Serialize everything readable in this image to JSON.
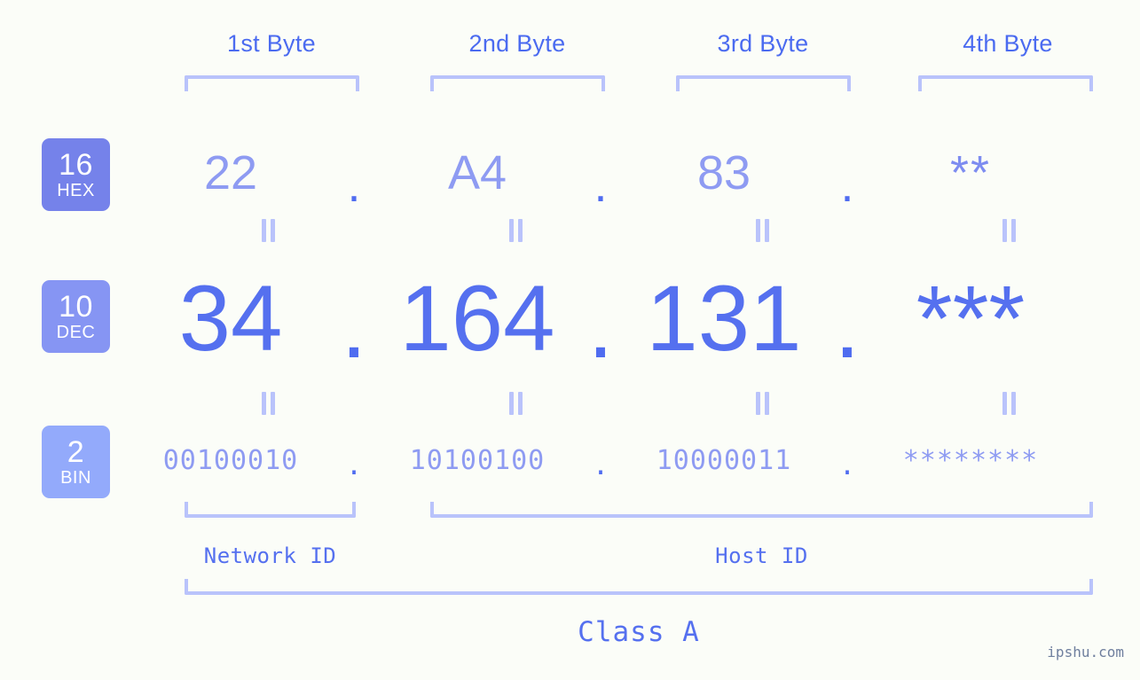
{
  "background": "#fbfdf8",
  "accent": "#5570ef",
  "accent_light": "#8e9bf2",
  "bracket_color": "#b9c3fb",
  "bytes": {
    "headers": [
      {
        "label": "1st Byte"
      },
      {
        "label": "2nd Byte"
      },
      {
        "label": "3rd Byte"
      },
      {
        "label": "4th Byte"
      }
    ]
  },
  "bases": [
    {
      "number": "16",
      "abbr": "HEX",
      "color": "#7582ea"
    },
    {
      "number": "10",
      "abbr": "DEC",
      "color": "#8695f3"
    },
    {
      "number": "2",
      "abbr": "BIN",
      "color": "#93aafb"
    }
  ],
  "rows": {
    "hex": {
      "values": [
        "22",
        "A4",
        "83",
        "**"
      ],
      "separators": [
        ".",
        ".",
        "."
      ]
    },
    "dec": {
      "values": [
        "34",
        "164",
        "131",
        "***"
      ],
      "separators": [
        ".",
        ".",
        "."
      ]
    },
    "bin": {
      "values": [
        "00100010",
        "10100100",
        "10000011",
        "********"
      ],
      "separators": [
        ".",
        ".",
        "."
      ]
    }
  },
  "equals_marks": {
    "symbol": "=",
    "count_per_row": 4
  },
  "sections": {
    "network_id": "Network ID",
    "host_id": "Host ID",
    "class": "Class A"
  },
  "watermark": "ipshu.com"
}
